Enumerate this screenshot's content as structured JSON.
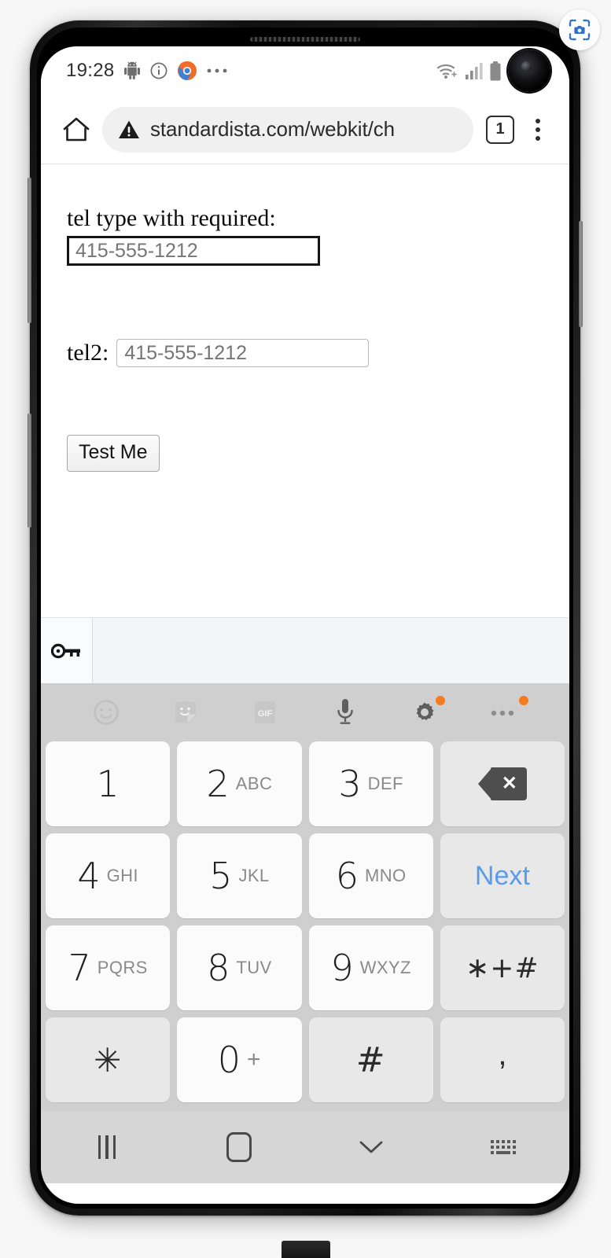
{
  "overlay": {
    "scan_icon": "screenshot-capture-icon"
  },
  "status_bar": {
    "clock": "19:28",
    "left_icons": [
      "android-robot-icon",
      "info-circle-icon",
      "chrome-icon",
      "more-dots-icon"
    ],
    "right_icons": [
      "wifi-icon",
      "cell-signal-icon",
      "battery-icon"
    ],
    "camera": "front-camera-punch-hole"
  },
  "browser": {
    "home_icon": "home-icon",
    "security_icon": "not-secure-warning-icon",
    "url": "standardista.com/webkit/ch",
    "tab_count": "1",
    "menu_icon": "overflow-menu-icon"
  },
  "page": {
    "field1_label": "tel type with required:",
    "field1_placeholder": "415-555-1212",
    "field1_value": "",
    "field2_label": "tel2:",
    "field2_placeholder": "415-555-1212",
    "field2_value": "",
    "submit_label": "Test Me"
  },
  "autofill": {
    "key_icon": "password-key-icon"
  },
  "keyboard": {
    "toolbar": [
      {
        "name": "emoji-icon",
        "badge": false
      },
      {
        "name": "sticker-icon",
        "badge": false
      },
      {
        "name": "gif-icon",
        "badge": false,
        "label": "GIF"
      },
      {
        "name": "microphone-icon",
        "badge": false
      },
      {
        "name": "settings-gear-icon",
        "badge": true
      },
      {
        "name": "keyboard-overflow-icon",
        "badge": true
      }
    ],
    "rows": [
      [
        {
          "digit": "1",
          "sub": "",
          "type": "num"
        },
        {
          "digit": "2",
          "sub": "ABC",
          "type": "num"
        },
        {
          "digit": "3",
          "sub": "DEF",
          "type": "num"
        },
        {
          "digit": "",
          "sub": "",
          "type": "backspace",
          "name": "backspace-key"
        }
      ],
      [
        {
          "digit": "4",
          "sub": "GHI",
          "type": "num"
        },
        {
          "digit": "5",
          "sub": "JKL",
          "type": "num"
        },
        {
          "digit": "6",
          "sub": "MNO",
          "type": "num"
        },
        {
          "digit": "",
          "sub": "",
          "type": "next",
          "label": "Next",
          "name": "next-key"
        }
      ],
      [
        {
          "digit": "7",
          "sub": "PQRS",
          "type": "num"
        },
        {
          "digit": "8",
          "sub": "TUV",
          "type": "num"
        },
        {
          "digit": "9",
          "sub": "WXYZ",
          "type": "num"
        },
        {
          "digit": "",
          "sub": "",
          "type": "sym",
          "label": "∗+#",
          "name": "symbols-key"
        }
      ],
      [
        {
          "digit": "",
          "sub": "",
          "type": "sym",
          "label": "✳",
          "name": "asterisk-key"
        },
        {
          "digit": "0",
          "sub": "+",
          "type": "num"
        },
        {
          "digit": "",
          "sub": "",
          "type": "sym",
          "label": "#",
          "name": "hash-key"
        },
        {
          "digit": "",
          "sub": "",
          "type": "comma",
          "label": ",",
          "name": "comma-key"
        }
      ]
    ],
    "next_color": "#5a9bea",
    "badge_color": "#f47b20"
  },
  "nav_bar": {
    "recents_icon": "recents-icon",
    "home_icon": "home-square-icon",
    "hide_keyboard_icon": "chevron-down-icon",
    "switch_keyboard_icon": "keyboard-switch-icon"
  }
}
